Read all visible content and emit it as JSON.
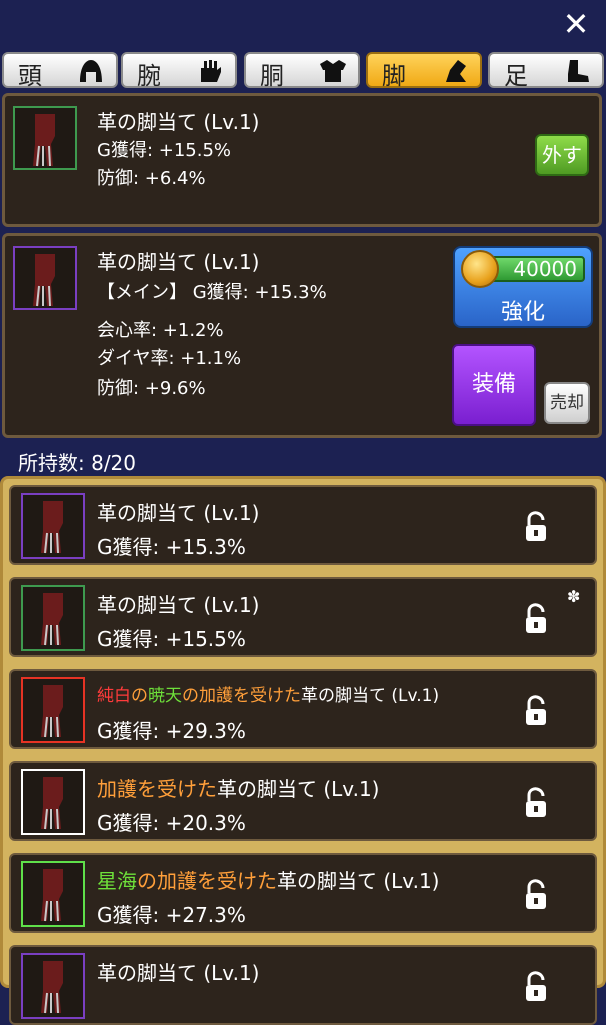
{
  "header": {
    "close_label": "✕"
  },
  "tabs": [
    {
      "label": "頭",
      "icon": "helmet-icon",
      "active": false
    },
    {
      "label": "腕",
      "icon": "glove-icon",
      "active": false
    },
    {
      "label": "胴",
      "icon": "armor-icon",
      "active": false
    },
    {
      "label": "脚",
      "icon": "leg-icon",
      "active": true
    },
    {
      "label": "足",
      "icon": "boot-icon",
      "active": false
    }
  ],
  "equipped": {
    "name": "革の脚当て (Lv.1)",
    "stat1": "G獲得: +15.5%",
    "stat2": "防御: +6.4%",
    "remove_label": "外す",
    "frame_color": "#3e9a4f"
  },
  "selected": {
    "name": "革の脚当て (Lv.1)",
    "main_stat": "【メイン】 G獲得: +15.3%",
    "stat1": "会心率: +1.2%",
    "stat2": "ダイヤ率: +1.1%",
    "stat3": "防御: +9.6%",
    "cost": "40000",
    "enhance_label": "強化",
    "equip_label": "装備",
    "sell_label": "売却",
    "frame_color": "#7a3fc2"
  },
  "inventory": {
    "count_label": "所持数: 8/20",
    "items": [
      {
        "prefix": [],
        "name": "革の脚当て (Lv.1)",
        "stat": "G獲得: +15.3%",
        "frame_color": "#7a3fc2",
        "stat_color": "white",
        "starred": false
      },
      {
        "prefix": [],
        "name": "革の脚当て (Lv.1)",
        "stat": "G獲得: +15.5%",
        "frame_color": "#3e9a4f",
        "stat_color": "white",
        "starred": true
      },
      {
        "prefix": [
          {
            "text": "純白",
            "color": "red"
          },
          {
            "text": "の",
            "color": "orange"
          },
          {
            "text": "暁天",
            "color": "green"
          },
          {
            "text": "の",
            "color": "orange"
          },
          {
            "text": "加護を受けた",
            "color": "orange"
          }
        ],
        "name": "革の脚当て (Lv.1)",
        "stat": "G獲得: +29.3%",
        "frame_color": "#e63324",
        "stat_color": "orange",
        "starred": false
      },
      {
        "prefix": [
          {
            "text": "加護を受けた",
            "color": "orange"
          }
        ],
        "name": "革の脚当て (Lv.1)",
        "stat": "G獲得: +20.3%",
        "frame_color": "#ffffff",
        "stat_color": "orange",
        "starred": false
      },
      {
        "prefix": [
          {
            "text": "星海",
            "color": "green"
          },
          {
            "text": "の",
            "color": "orange"
          },
          {
            "text": "加護を受けた",
            "color": "orange"
          }
        ],
        "name": "革の脚当て (Lv.1)",
        "stat": "G獲得: +27.3%",
        "frame_color": "#5fe04a",
        "stat_color": "orange",
        "starred": false
      },
      {
        "prefix": [],
        "name": "革の脚当て (Lv.1)",
        "stat": "",
        "frame_color": "#7a3fc2",
        "stat_color": "white",
        "starred": false
      }
    ]
  },
  "colors": {
    "background": "#1c2152",
    "panel": "#2d241c",
    "list_border": "#d3b35f"
  }
}
